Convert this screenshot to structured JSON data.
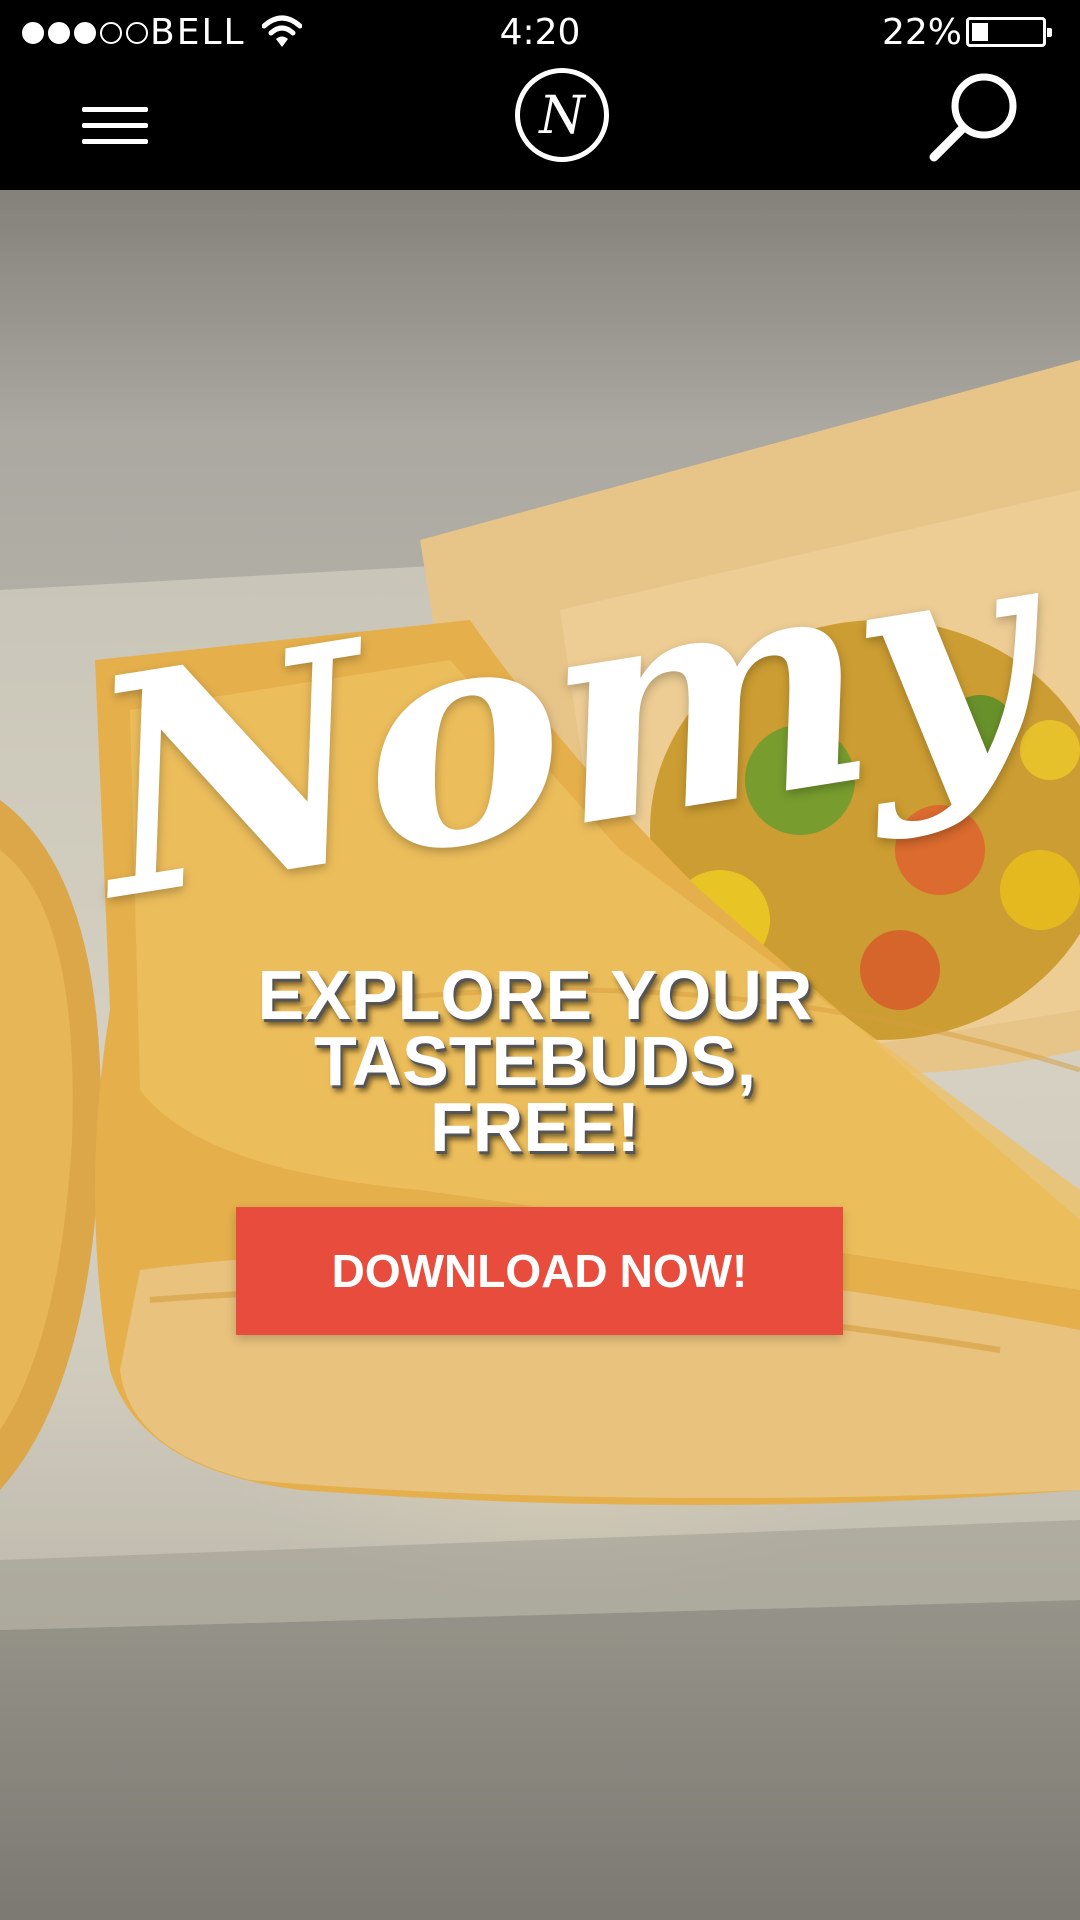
{
  "status_bar": {
    "signal_strength": 3,
    "signal_max": 5,
    "carrier": "BELL",
    "time": "4:20",
    "battery_percent": "22%",
    "battery_level": 0.22
  },
  "nav": {
    "logo_letter": "N",
    "menu_icon": "hamburger-menu-icon",
    "search_icon": "search-icon"
  },
  "hero": {
    "brand": "Nomy",
    "tagline_lines": [
      "EXPLORE YOUR",
      "TASTEBUDS,",
      "FREE!"
    ],
    "cta_regular": "DOWNLOAD",
    "cta_bold": "NOW!",
    "cta_color": "#e74c3c"
  }
}
